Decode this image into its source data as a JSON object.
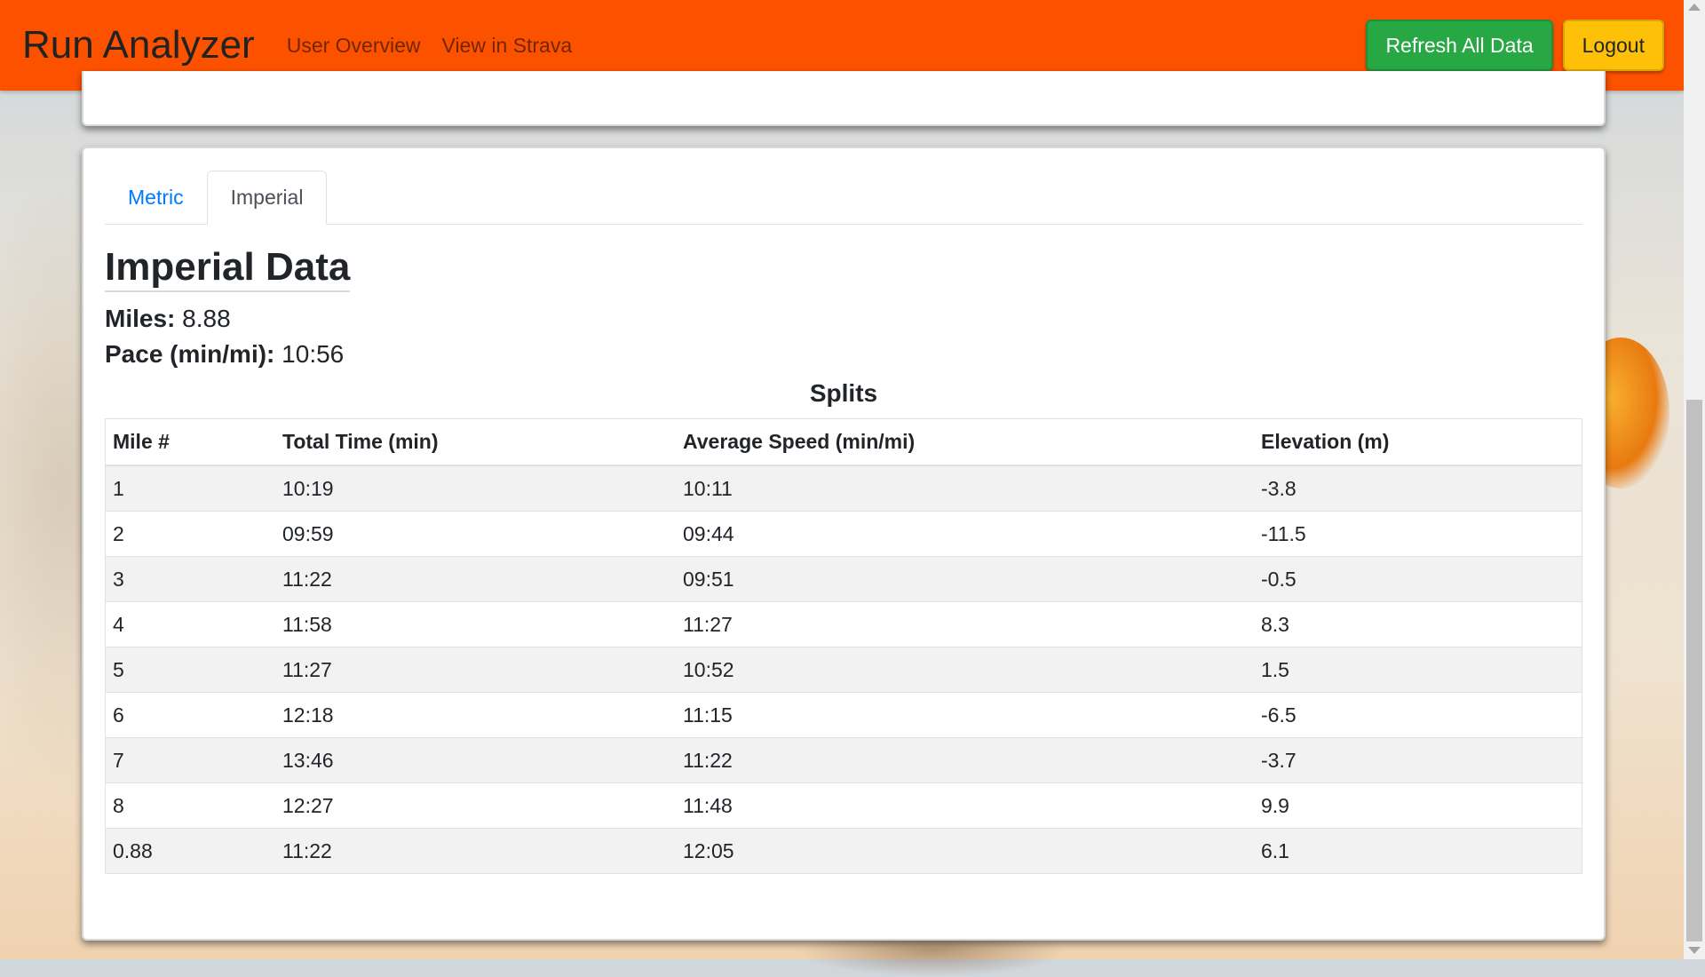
{
  "app": {
    "brand": "Run Analyzer",
    "nav_links": [
      "User Overview",
      "View in Strava"
    ],
    "refresh_label": "Refresh All Data",
    "logout_label": "Logout"
  },
  "colors": {
    "navbar": "#fc5200",
    "refresh_button": "#28a745",
    "logout_button": "#ffc107",
    "tab_link": "#007bff"
  },
  "tabs": [
    {
      "label": "Metric",
      "active": false
    },
    {
      "label": "Imperial",
      "active": true
    }
  ],
  "section": {
    "heading": "Imperial Data",
    "miles_label": "Miles:",
    "miles_value": "8.88",
    "pace_label": "Pace (min/mi):",
    "pace_value": "10:56",
    "splits_title": "Splits"
  },
  "splits_table": {
    "headers": [
      "Mile #",
      "Total Time (min)",
      "Average Speed (min/mi)",
      "Elevation (m)"
    ],
    "rows": [
      [
        "1",
        "10:19",
        "10:11",
        "-3.8"
      ],
      [
        "2",
        "09:59",
        "09:44",
        "-11.5"
      ],
      [
        "3",
        "11:22",
        "09:51",
        "-0.5"
      ],
      [
        "4",
        "11:58",
        "11:27",
        "8.3"
      ],
      [
        "5",
        "11:27",
        "10:52",
        "1.5"
      ],
      [
        "6",
        "12:18",
        "11:15",
        "-6.5"
      ],
      [
        "7",
        "13:46",
        "11:22",
        "-3.7"
      ],
      [
        "8",
        "12:27",
        "11:48",
        "9.9"
      ],
      [
        "0.88",
        "11:22",
        "12:05",
        "6.1"
      ]
    ]
  }
}
